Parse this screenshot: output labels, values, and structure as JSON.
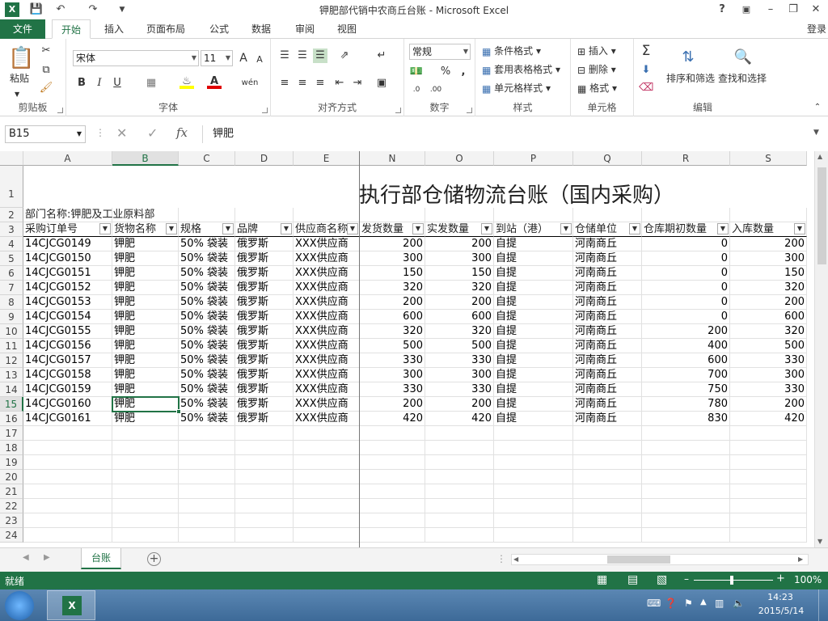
{
  "window": {
    "title": "钾肥部代销中农商丘台账 - Microsoft Excel",
    "help": "?",
    "minimize": "–",
    "restore": "❐",
    "close": "✕"
  },
  "ribbon_tabs": [
    "文件",
    "开始",
    "插入",
    "页面布局",
    "公式",
    "数据",
    "审阅",
    "视图"
  ],
  "active_tab": "开始",
  "login": "登录",
  "ribbon": {
    "clipboard": {
      "label": "剪贴板",
      "paste": "粘贴"
    },
    "font": {
      "label": "字体",
      "name": "宋体",
      "size": "11",
      "bold": "B",
      "italic": "I",
      "underline": "U",
      "phonetic": "wén"
    },
    "alignment": {
      "label": "对齐方式"
    },
    "number": {
      "label": "数字",
      "format": "常规"
    },
    "styles": {
      "label": "样式",
      "conditional": "条件格式",
      "table": "套用表格格式",
      "cell_styles": "单元格样式"
    },
    "cells": {
      "label": "单元格",
      "insert": "插入",
      "delete": "删除",
      "format": "格式"
    },
    "editing": {
      "label": "编辑",
      "sort": "排序和筛选",
      "find": "查找和选择"
    }
  },
  "formula_bar": {
    "name_box": "B15",
    "fx": "fx",
    "content": "钾肥"
  },
  "columns": [
    "A",
    "B",
    "C",
    "D",
    "E",
    "N",
    "O",
    "P",
    "Q",
    "R",
    "S"
  ],
  "selected_column": "B",
  "selected_row": 15,
  "sheet": {
    "title": "执行部仓储物流台账（国内采购）",
    "department": "部门名称:钾肥及工业原料部",
    "headers": [
      "采购订单号",
      "货物名称",
      "规格",
      "品牌",
      "供应商名称",
      "发货数量",
      "实发数量",
      "到站（港）",
      "仓储单位",
      "仓库期初数量",
      "入库数量"
    ],
    "rows": [
      [
        "14CJCG0149",
        "钾肥",
        "50% 袋装",
        "俄罗斯",
        "XXX供应商",
        "200",
        "200",
        "自提",
        "河南商丘",
        "0",
        "200"
      ],
      [
        "14CJCG0150",
        "钾肥",
        "50% 袋装",
        "俄罗斯",
        "XXX供应商",
        "300",
        "300",
        "自提",
        "河南商丘",
        "0",
        "300"
      ],
      [
        "14CJCG0151",
        "钾肥",
        "50% 袋装",
        "俄罗斯",
        "XXX供应商",
        "150",
        "150",
        "自提",
        "河南商丘",
        "0",
        "150"
      ],
      [
        "14CJCG0152",
        "钾肥",
        "50% 袋装",
        "俄罗斯",
        "XXX供应商",
        "320",
        "320",
        "自提",
        "河南商丘",
        "0",
        "320"
      ],
      [
        "14CJCG0153",
        "钾肥",
        "50% 袋装",
        "俄罗斯",
        "XXX供应商",
        "200",
        "200",
        "自提",
        "河南商丘",
        "0",
        "200"
      ],
      [
        "14CJCG0154",
        "钾肥",
        "50% 袋装",
        "俄罗斯",
        "XXX供应商",
        "600",
        "600",
        "自提",
        "河南商丘",
        "0",
        "600"
      ],
      [
        "14CJCG0155",
        "钾肥",
        "50% 袋装",
        "俄罗斯",
        "XXX供应商",
        "320",
        "320",
        "自提",
        "河南商丘",
        "200",
        "320"
      ],
      [
        "14CJCG0156",
        "钾肥",
        "50% 袋装",
        "俄罗斯",
        "XXX供应商",
        "500",
        "500",
        "自提",
        "河南商丘",
        "400",
        "500"
      ],
      [
        "14CJCG0157",
        "钾肥",
        "50% 袋装",
        "俄罗斯",
        "XXX供应商",
        "330",
        "330",
        "自提",
        "河南商丘",
        "600",
        "330"
      ],
      [
        "14CJCG0158",
        "钾肥",
        "50% 袋装",
        "俄罗斯",
        "XXX供应商",
        "300",
        "300",
        "自提",
        "河南商丘",
        "700",
        "300"
      ],
      [
        "14CJCG0159",
        "钾肥",
        "50% 袋装",
        "俄罗斯",
        "XXX供应商",
        "330",
        "330",
        "自提",
        "河南商丘",
        "750",
        "330"
      ],
      [
        "14CJCG0160",
        "钾肥",
        "50% 袋装",
        "俄罗斯",
        "XXX供应商",
        "200",
        "200",
        "自提",
        "河南商丘",
        "780",
        "200"
      ],
      [
        "14CJCG0161",
        "钾肥",
        "50% 袋装",
        "俄罗斯",
        "XXX供应商",
        "420",
        "420",
        "自提",
        "河南商丘",
        "830",
        "420"
      ]
    ],
    "row_numbers": [
      "1",
      "2",
      "3",
      "4",
      "5",
      "6",
      "7",
      "8",
      "9",
      "10",
      "11",
      "12",
      "13",
      "14",
      "15",
      "16",
      "17",
      "18",
      "19",
      "20",
      "21",
      "22",
      "23",
      "24"
    ]
  },
  "sheet_tab": "台账",
  "add_sheet": "+",
  "status": {
    "ready": "就绪",
    "zoom": "100%"
  },
  "taskbar": {
    "time": "14:23",
    "date": "2015/5/14"
  }
}
